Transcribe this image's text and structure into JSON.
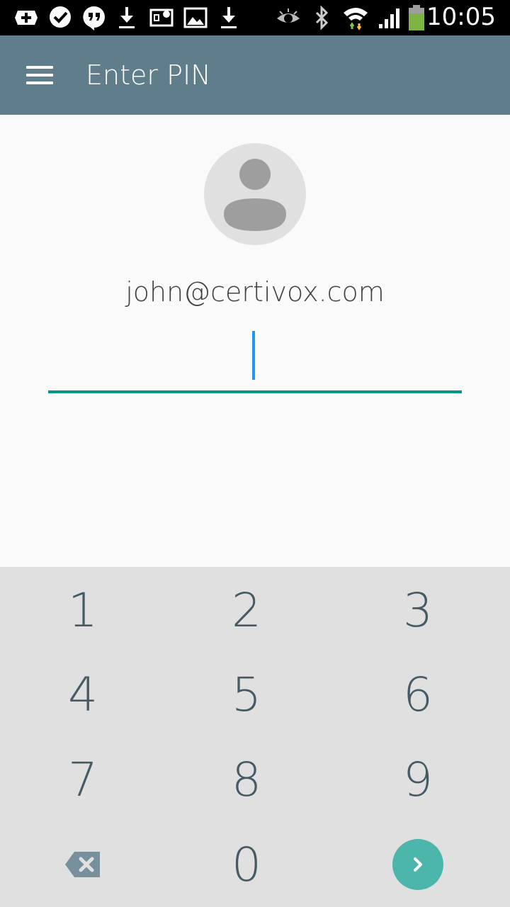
{
  "status_bar": {
    "time": "10:05",
    "icons": [
      "add-icon",
      "checkmark-heart-icon",
      "hangouts-quote-icon",
      "download-icon",
      "sim-icon",
      "image-icon",
      "download-icon",
      "eye-icon",
      "bluetooth-icon",
      "wifi-icon",
      "signal-icon",
      "battery-icon"
    ]
  },
  "app_bar": {
    "title": "Enter PIN",
    "menu_icon": "hamburger-menu-icon"
  },
  "account": {
    "email": "john@certivox.com",
    "avatar_icon": "person-avatar-icon"
  },
  "pin": {
    "value": ""
  },
  "keypad": {
    "keys": [
      "1",
      "2",
      "3",
      "4",
      "5",
      "6",
      "7",
      "8",
      "9",
      "0"
    ],
    "backspace_icon": "backspace-icon",
    "next_icon": "chevron-right-icon"
  },
  "colors": {
    "app_bar": "#607d8b",
    "accent": "#009688",
    "caret": "#2196f3",
    "next_button": "#4db6ac",
    "keypad_bg": "#e0e0e0",
    "key_text": "#455a64"
  }
}
